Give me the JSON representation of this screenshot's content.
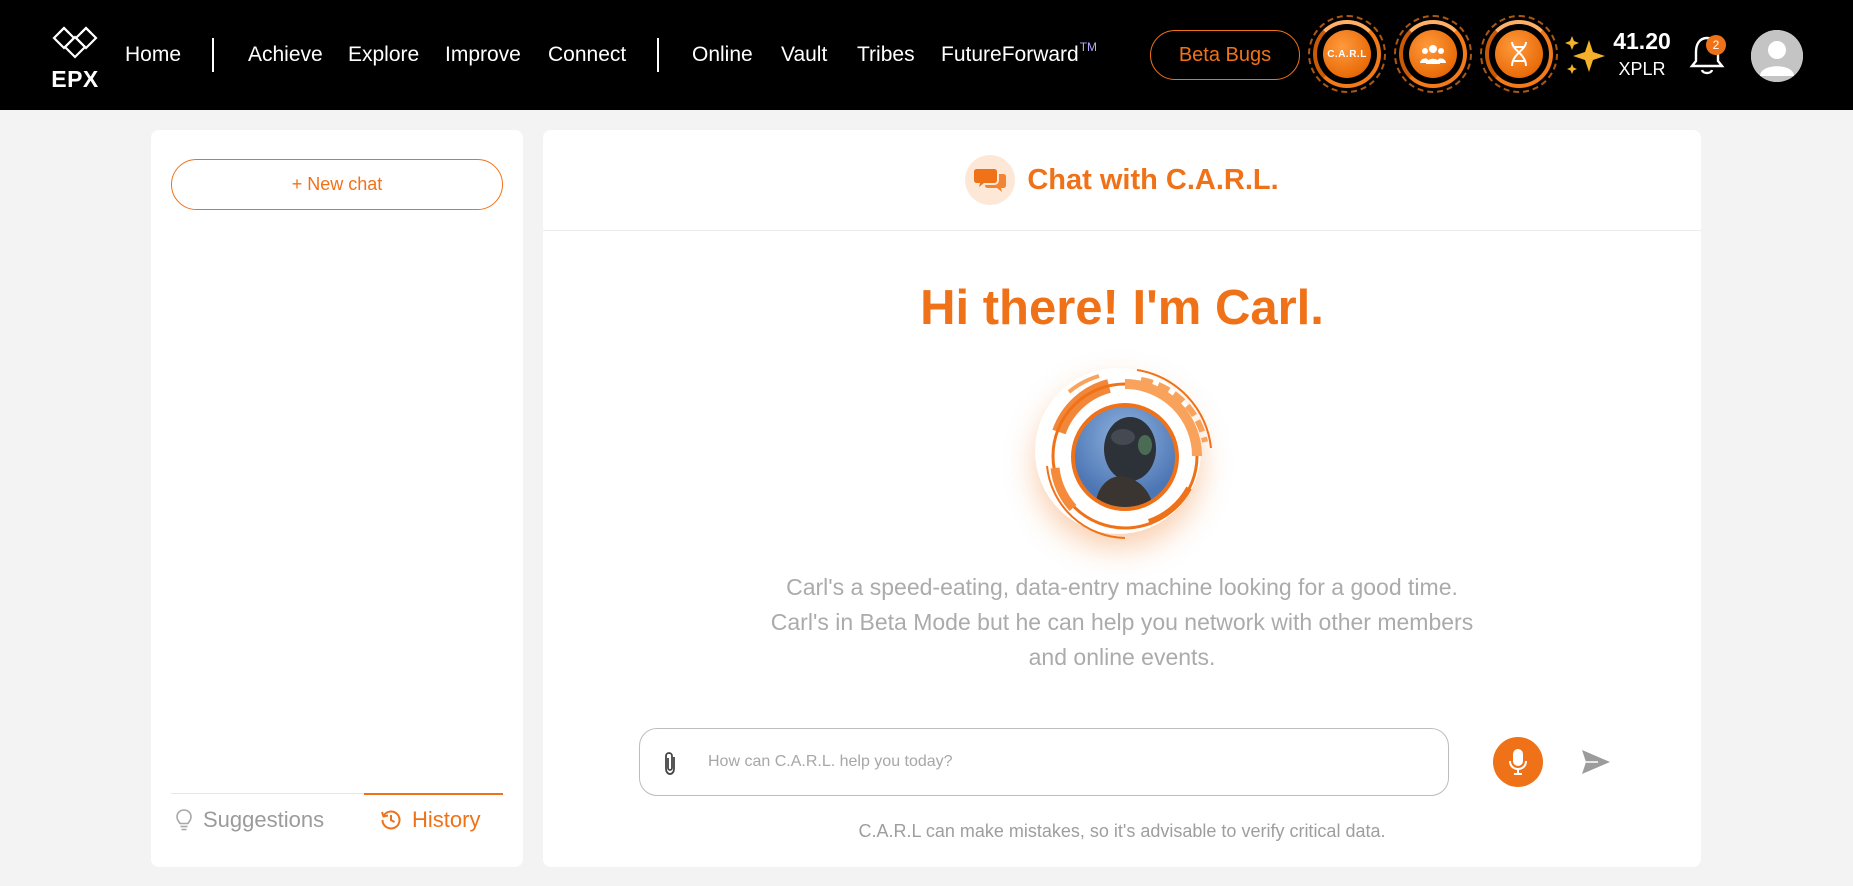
{
  "brand": {
    "logo_text": "EPX",
    "logo_icon": "epx-logo-icon"
  },
  "nav": {
    "group1": [
      "Home"
    ],
    "group2": [
      "Achieve",
      "Explore",
      "Improve",
      "Connect"
    ],
    "group3": [
      "Online",
      "Vault",
      "Tribes",
      "FutureForward"
    ],
    "trademark": "TM"
  },
  "header_actions": {
    "beta_bugs_label": "Beta Bugs",
    "carl_badge_text": "C.A.R.L",
    "icons": [
      "carl-icon",
      "tribe-icon",
      "dna-icon",
      "sparkle-icon",
      "bell-icon",
      "user-avatar-icon"
    ],
    "xp_value": "41.20",
    "xp_unit": "XPLR",
    "notification_count": "2"
  },
  "sidebar": {
    "new_chat_label": "+ New chat",
    "tabs": [
      {
        "label": "Suggestions",
        "icon": "lightbulb-icon",
        "active": false
      },
      {
        "label": "History",
        "icon": "history-icon",
        "active": true
      }
    ]
  },
  "chat": {
    "title": "Chat with C.A.R.L.",
    "greeting": "Hi there! I'm Carl.",
    "description": [
      "Carl's a speed-eating, data-entry machine looking for a good time.",
      "Carl's in Beta Mode but he can help you network with other members",
      "and online events."
    ],
    "input_placeholder": "How can C.A.R.L. help you today?",
    "input_value": "",
    "disclaimer": "C.A.R.L can make mistakes, so it's advisable to verify critical data."
  },
  "colors": {
    "accent": "#f07218",
    "topbar_bg": "#000000",
    "page_bg": "#f3f3f3",
    "muted_text": "#ababab"
  }
}
